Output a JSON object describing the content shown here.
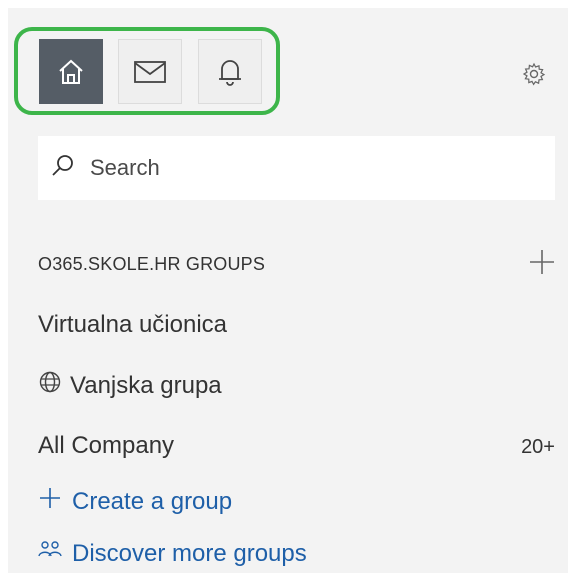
{
  "nav": {
    "tabs": [
      {
        "icon": "home-icon",
        "active": true
      },
      {
        "icon": "mail-icon",
        "active": false
      },
      {
        "icon": "bell-icon",
        "active": false
      }
    ],
    "settings_icon": "gear-icon",
    "highlight_color": "#3db54a"
  },
  "search": {
    "placeholder": "Search",
    "value": ""
  },
  "groups_section": {
    "title": "O365.SKOLE.HR GROUPS",
    "add_icon": "plus-icon",
    "items": [
      {
        "label": "Virtualna učionica"
      },
      {
        "label": "Vanjska grupa",
        "icon": "globe-icon"
      },
      {
        "label": "All Company",
        "count": "20+"
      }
    ]
  },
  "actions": {
    "create_group": "Create a group",
    "discover_groups": "Discover more groups"
  },
  "colors": {
    "active_tab": "#555d66",
    "link": "#1e5fa8",
    "panel_bg": "#f3f3f3"
  }
}
